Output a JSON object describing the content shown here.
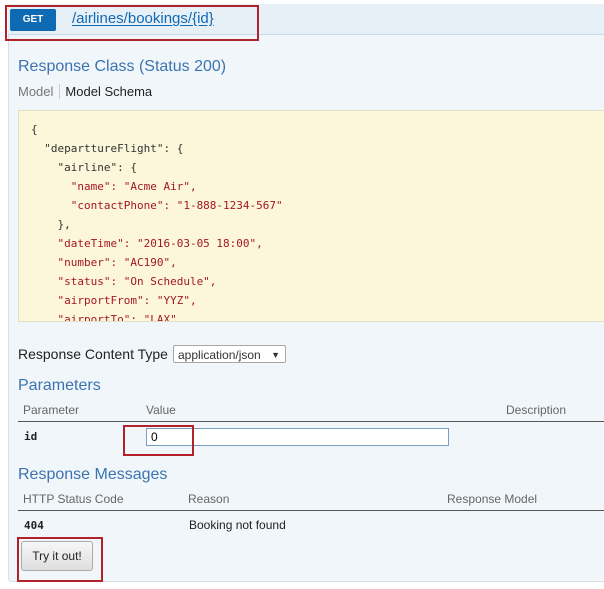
{
  "operation": {
    "method": "GET",
    "path": "/airlines/bookings/{id}"
  },
  "response_class": {
    "title": "Response Class (Status 200)",
    "tabs": [
      "Model",
      "Model Schema"
    ],
    "schema_lines": [
      "{",
      "  \"departtureFlight\": {",
      "    \"airline\": {",
      "      \"name\": \"Acme Air\",",
      "      \"contactPhone\": \"1-888-1234-567\"",
      "    },",
      "    \"dateTime\": \"2016-03-05 18:00\",",
      "    \"number\": \"AC190\",",
      "    \"status\": \"On Schedule\",",
      "    \"airportFrom\": \"YYZ\",",
      "    \"airportTo\": \"LAX\","
    ]
  },
  "response_content_type": {
    "label": "Response Content Type",
    "selected": "application/json"
  },
  "parameters": {
    "title": "Parameters",
    "headers": [
      "Parameter",
      "Value",
      "Description"
    ],
    "rows": [
      {
        "name": "id",
        "value": "0",
        "description": ""
      }
    ]
  },
  "response_messages": {
    "title": "Response Messages",
    "headers": [
      "HTTP Status Code",
      "Reason",
      "Response Model"
    ],
    "rows": [
      {
        "code": "404",
        "reason": "Booking not found",
        "model": ""
      }
    ]
  },
  "actions": {
    "try_label": "Try it out!"
  },
  "colors": {
    "accent": "#0f6ab4",
    "highlight": "#b1222b",
    "schema_bg": "#fcf6db"
  }
}
